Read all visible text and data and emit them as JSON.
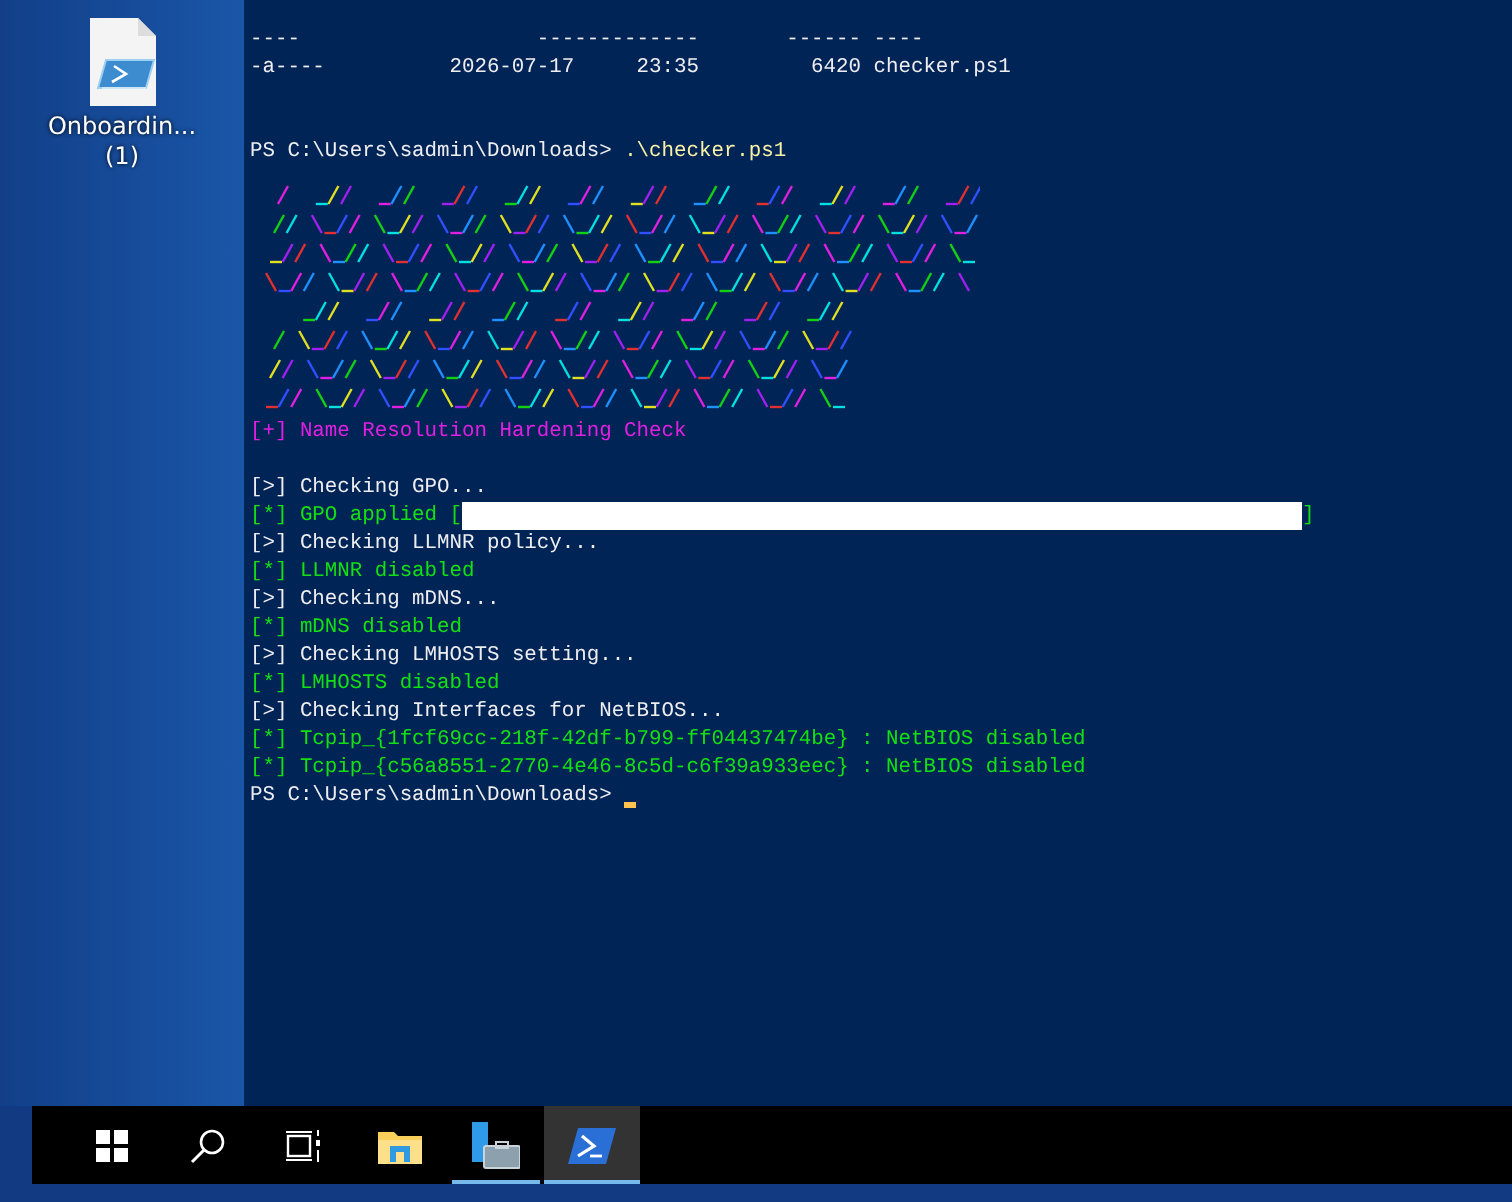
{
  "desktop_icons": [
    {
      "label": "Onboardin... (1)"
    }
  ],
  "terminal": {
    "listing": [
      {
        "mode": "----",
        "time": "-------------",
        "length": "------",
        "name": "----"
      },
      {
        "mode": "-a----",
        "time": "2026-07-17     23:35",
        "length": "6420",
        "name": "checker.ps1"
      }
    ],
    "command": {
      "prompt": "PS C:\\Users\\sadmin\\Downloads>",
      "text": ".\\checker.ps1"
    },
    "lines": [
      {
        "kind": "title",
        "text": "[+] Name Resolution Hardening Check"
      },
      {
        "kind": "blank"
      },
      {
        "kind": "info",
        "text": "[>] Checking GPO..."
      },
      {
        "kind": "ok",
        "text": "[*] GPO applied [",
        "redacted": true,
        "suffix": "]"
      },
      {
        "kind": "info",
        "text": "[>] Checking LLMNR policy..."
      },
      {
        "kind": "ok",
        "text": "[*] LLMNR disabled"
      },
      {
        "kind": "info",
        "text": "[>] Checking mDNS..."
      },
      {
        "kind": "ok",
        "text": "[*] mDNS disabled"
      },
      {
        "kind": "info",
        "text": "[>] Checking LMHOSTS setting..."
      },
      {
        "kind": "ok",
        "text": "[*] LMHOSTS disabled"
      },
      {
        "kind": "info",
        "text": "[>] Checking Interfaces for NetBIOS..."
      },
      {
        "kind": "ok",
        "text": "[*] Tcpip_{1fcf69cc-218f-42df-b799-ff04437474be} : NetBIOS disabled"
      },
      {
        "kind": "ok",
        "text": "[*] Tcpip_{c56a8551-2770-4e46-8c5d-c6f39a933eec} : NetBIOS disabled"
      }
    ],
    "final_prompt": "PS C:\\Users\\sadmin\\Downloads>"
  },
  "taskbar": [
    {
      "kind": "start",
      "running": false,
      "selected": false
    },
    {
      "kind": "search",
      "running": false,
      "selected": false
    },
    {
      "kind": "taskview",
      "running": false,
      "selected": false
    },
    {
      "kind": "explorer",
      "running": false,
      "selected": false
    },
    {
      "kind": "server",
      "running": true,
      "selected": false
    },
    {
      "kind": "powershell",
      "running": true,
      "selected": true
    }
  ]
}
